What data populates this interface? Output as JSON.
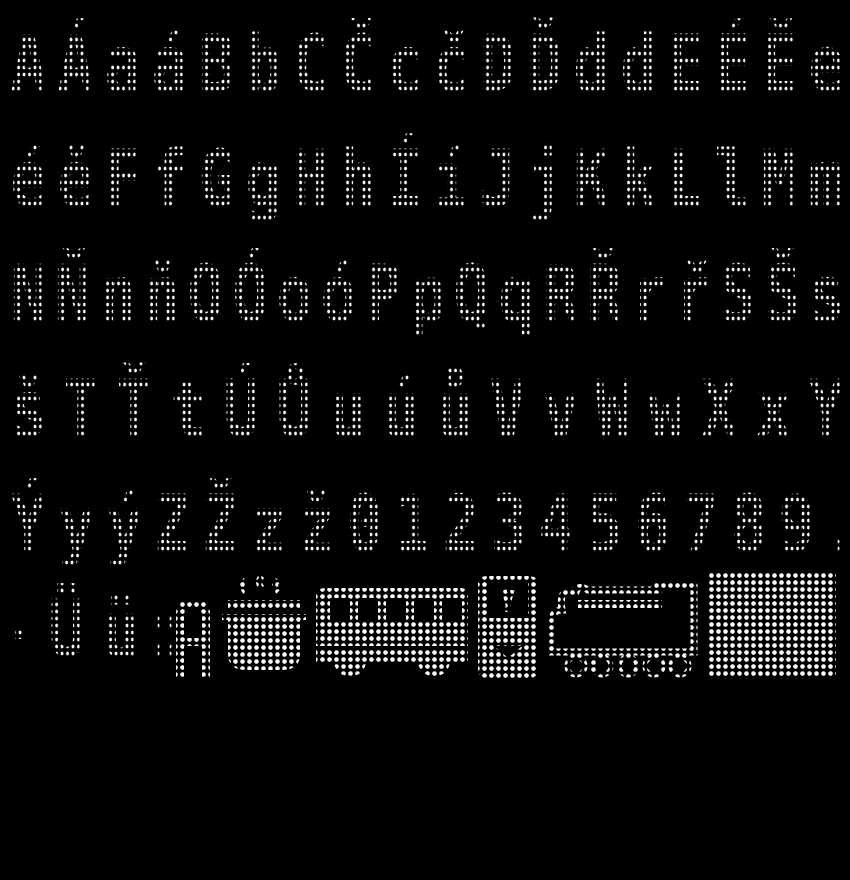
{
  "rows": [
    [
      "A",
      "Á",
      "a",
      "á",
      "B",
      "b",
      "C",
      "Č",
      "c",
      "č",
      "D",
      "Ď",
      "d",
      "ď",
      "E",
      "É",
      "Ě",
      "e"
    ],
    [
      "é",
      "ě",
      "F",
      "f",
      "G",
      "g",
      "H",
      "h",
      "Í",
      "í",
      "J",
      "j",
      "K",
      "k",
      "L",
      "l",
      "M",
      "m"
    ],
    [
      "N",
      "Ň",
      "n",
      "ň",
      "O",
      "Ó",
      "o",
      "ó",
      "P",
      "p",
      "Q",
      "q",
      "R",
      "Ř",
      "r",
      "ř",
      "S",
      "Š",
      "s"
    ],
    [
      "š",
      "T",
      "Ť",
      "t",
      "Ú",
      "Ů",
      "u",
      "ú",
      "ů",
      "V",
      "v",
      "W",
      "w",
      "X",
      "x",
      "Y"
    ],
    [
      "Ý",
      "y",
      "ý",
      "Z",
      "Ž",
      "z",
      "ž",
      "0",
      "1",
      "2",
      "3",
      "4",
      "5",
      "6",
      "7",
      "8",
      "9",
      "."
    ],
    [
      "-",
      "Ü",
      "ü",
      ":"
    ]
  ],
  "icons": [
    "pot-icon",
    "bus-icon",
    "train-front-icon",
    "locomotive-icon",
    "solid-block-icon"
  ],
  "colors": {
    "background": "#000000",
    "dots": "#ffffff"
  }
}
